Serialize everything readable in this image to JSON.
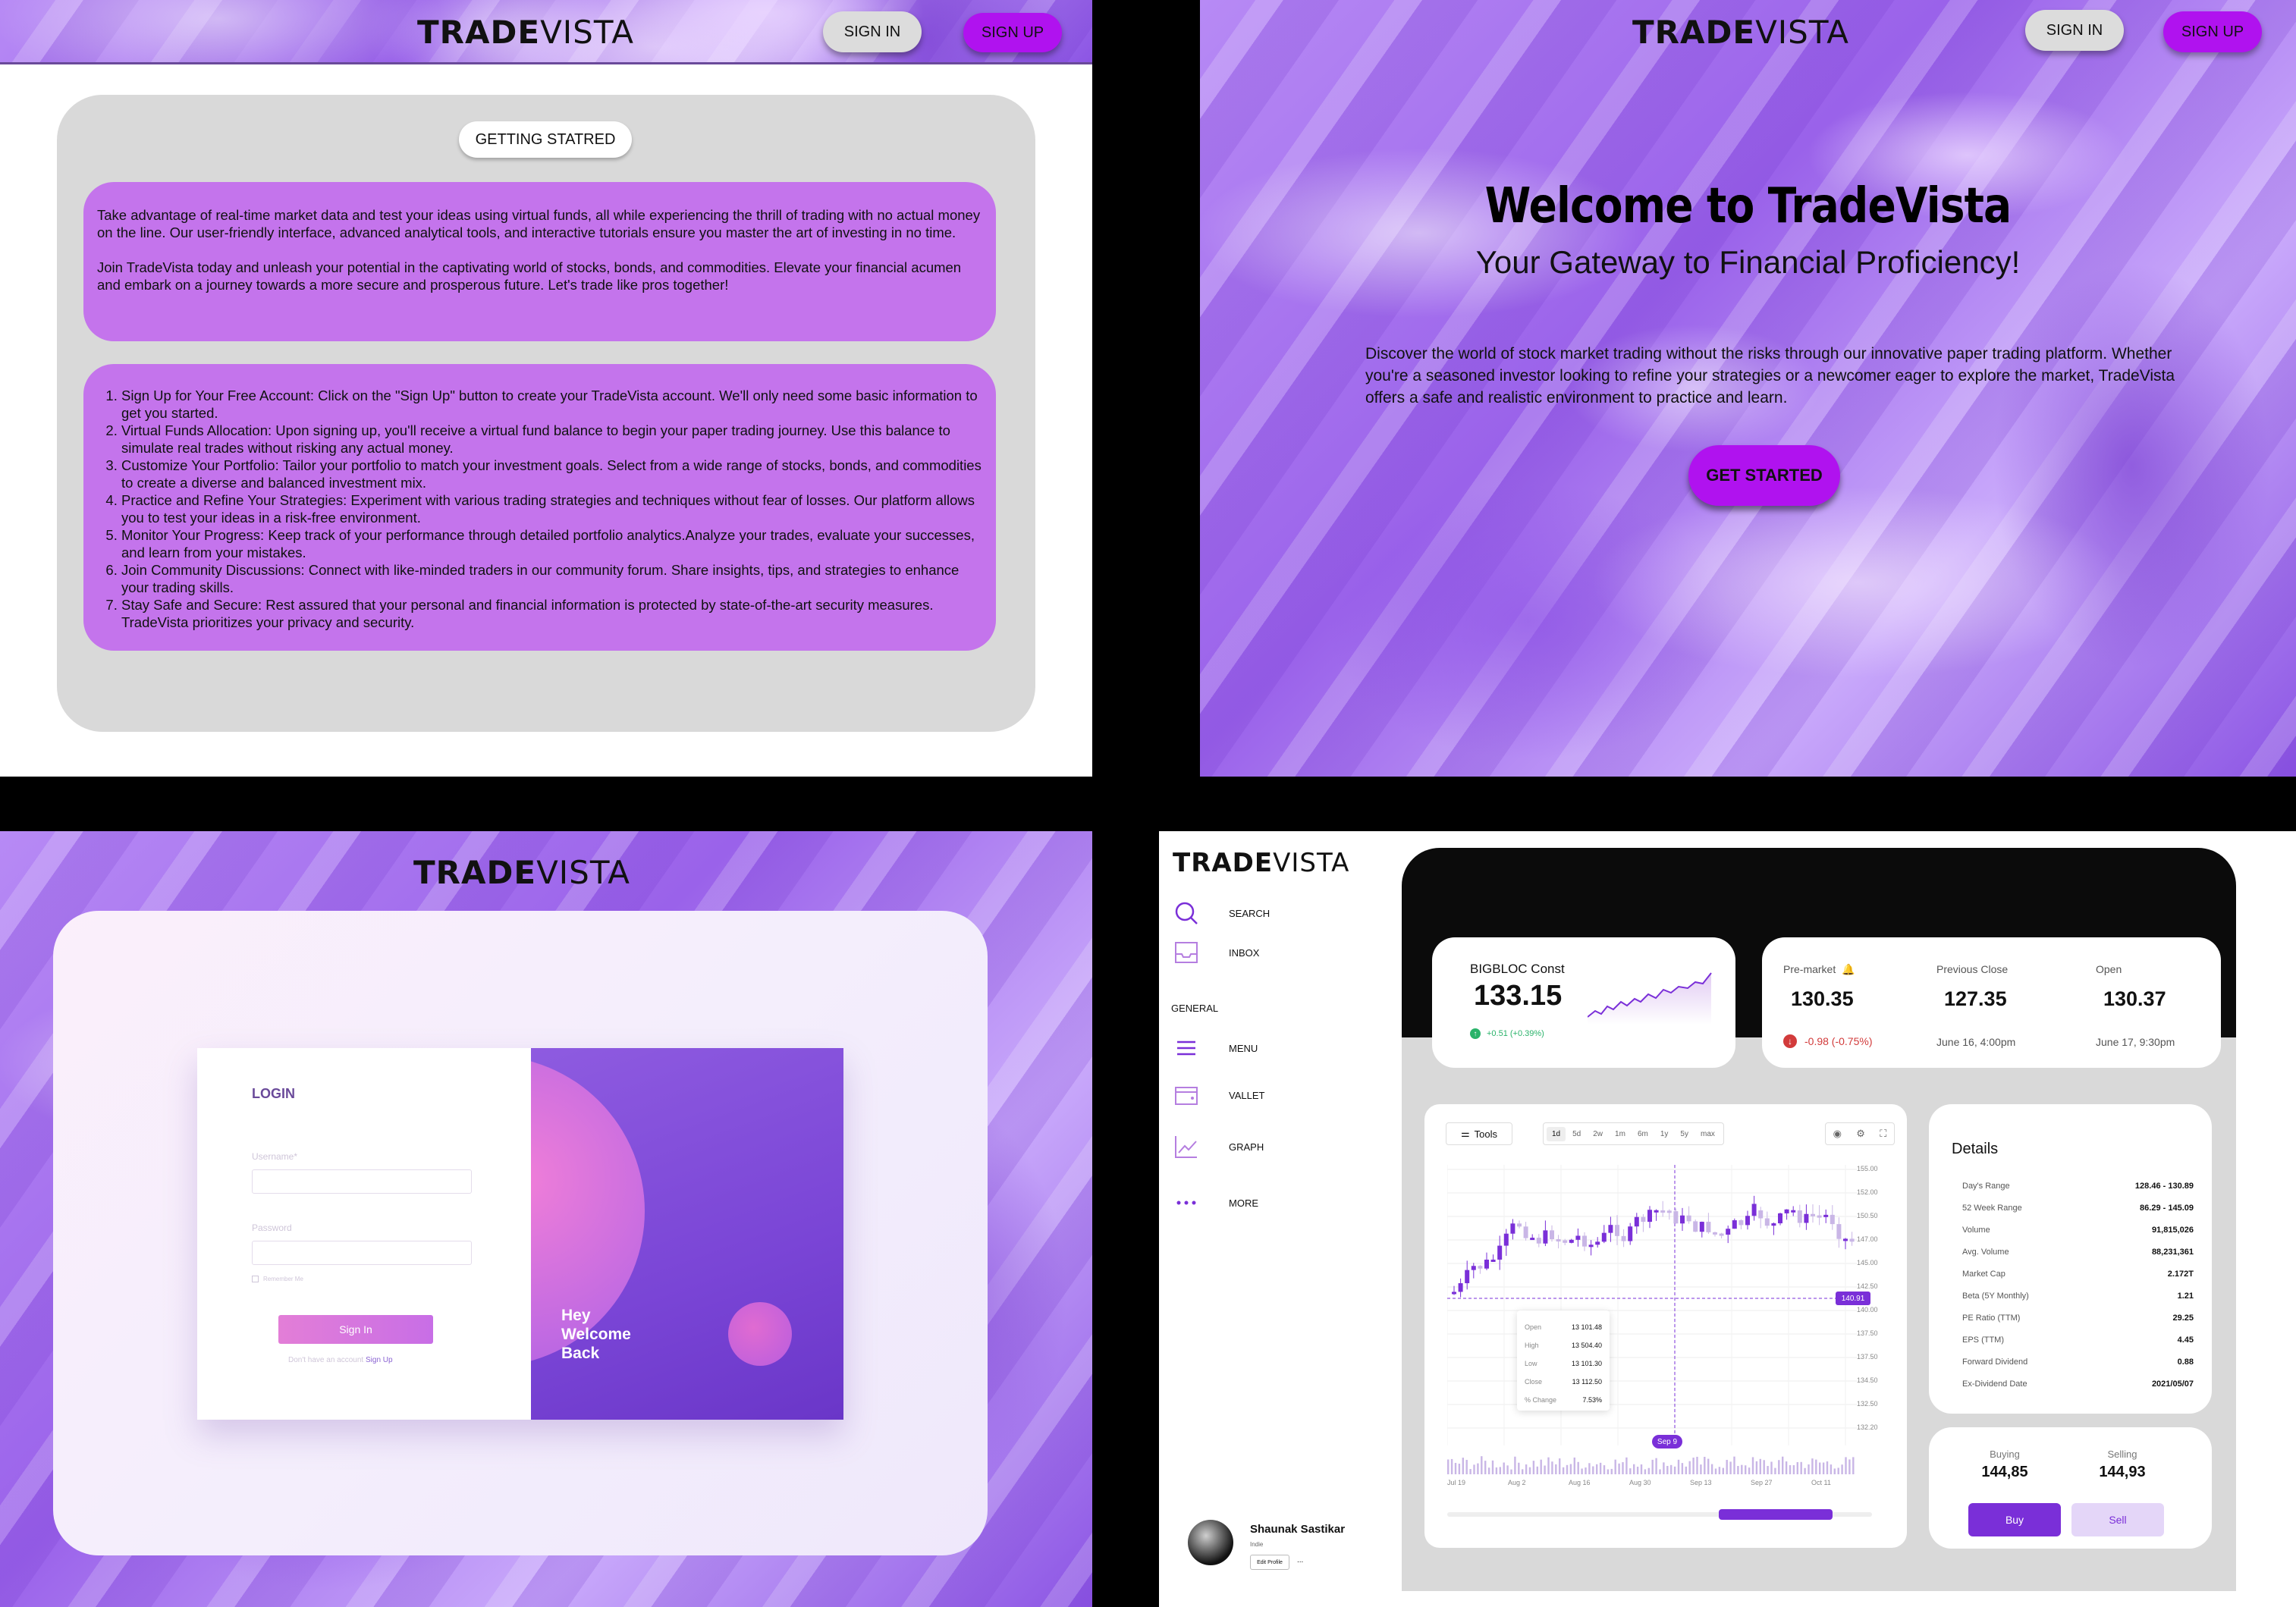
{
  "brand": {
    "bold": "TRADE",
    "light": "VISTA"
  },
  "q1": {
    "signin": "SIGN IN",
    "signup": "SIGN UP",
    "getting_started": "GETTING STATRED",
    "intro_p1": "Take advantage of real-time market data and test your ideas using virtual funds, all while experiencing the thrill of trading with no actual money on the line. Our user-friendly interface, advanced analytical tools, and interactive tutorials ensure you master the art of investing in no time.",
    "intro_p2": "Join TradeVista today and unleash your potential in the captivating world of stocks, bonds, and commodities. Elevate your financial acumen and embark on a journey towards a more secure and prosperous future. Let's trade like pros together!",
    "steps": [
      "Sign Up for Your Free Account: Click on the \"Sign Up\" button to create your TradeVista account. We'll only need some basic information to get you started.",
      "Virtual Funds Allocation: Upon signing up, you'll receive a virtual fund balance to begin your paper trading journey. Use this balance to simulate real trades without risking any actual money.",
      "Customize Your Portfolio: Tailor your portfolio to match your investment goals. Select from a wide range of stocks, bonds, and commodities to create a diverse and balanced investment mix.",
      "Practice and Refine Your Strategies: Experiment with various trading strategies and techniques without fear of losses. Our platform allows you to test your ideas in a risk-free environment.",
      "Monitor Your Progress: Keep track of your performance through detailed portfolio analytics.Analyze your trades, evaluate your successes, and learn from your mistakes.",
      "Join Community Discussions: Connect with like-minded traders in our community forum. Share insights, tips, and strategies to enhance your trading skills.",
      "Stay Safe and Secure: Rest assured that your personal and financial information is protected by state-of-the-art security measures. TradeVista prioritizes your privacy and security."
    ]
  },
  "q2": {
    "signin": "SIGN IN",
    "signup": "SIGN UP",
    "title": "Welcome to TradeVista",
    "subtitle": "Your Gateway to Financial Proficiency!",
    "description": "Discover the world of stock market trading without the risks through our innovative paper trading platform. Whether you're a seasoned investor looking to refine your strategies or a newcomer eager to explore the market, TradeVista offers a safe and realistic environment to practice and learn.",
    "cta": "GET STARTED"
  },
  "q3": {
    "login_title": "LOGIN",
    "username_label": "Username*",
    "password_label": "Password",
    "remember": "Remember Me",
    "signin_btn": "Sign In",
    "no_account": "Don't have an account ",
    "signup_link": "Sign Up",
    "welcome": "Hey\nWelcome\nBack"
  },
  "q4": {
    "nav": {
      "search": "SEARCH",
      "inbox": "INBOX",
      "general": "GENERAL",
      "menu": "MENU",
      "vallet": "VALLET",
      "graph": "GRAPH",
      "more": "MORE"
    },
    "profile": {
      "name": "Shaunak Sastikar",
      "sub": "Indie",
      "edit": "Edit Profile",
      "more": "..."
    },
    "ticker": {
      "name": "BIGBLOC Const",
      "price": "133.15",
      "change": "+0.51 (+0.39%)"
    },
    "quotes": [
      {
        "label": "Pre-market",
        "value": "130.35",
        "sub": "-0.98 (-0.75%)"
      },
      {
        "label": "Previous Close",
        "value": "127.35",
        "sub": "June 16, 4:00pm"
      },
      {
        "label": "Open",
        "value": "130.37",
        "sub": "June 17, 9:30pm"
      }
    ],
    "tools": "Tools",
    "ranges": [
      "1d",
      "5d",
      "2w",
      "1m",
      "6m",
      "1y",
      "5y",
      "max"
    ],
    "price_axis": [
      "155.00",
      "152.00",
      "150.50",
      "147.00",
      "145.00",
      "142.50",
      "140.00",
      "137.50",
      "137.50",
      "134.50",
      "132.50",
      "132.20"
    ],
    "date_axis": [
      "Jul 19",
      "Aug 2",
      "Aug 16",
      "Aug 30",
      "Sep 13",
      "Sep 27",
      "Oct 11"
    ],
    "current_price_tag": "140.91",
    "cursor_date": "Sep 9",
    "ohlc": [
      {
        "k": "Open",
        "v": "13 101.48"
      },
      {
        "k": "High",
        "v": "13 504.40"
      },
      {
        "k": "Low",
        "v": "13 101.30"
      },
      {
        "k": "Close",
        "v": "13 112.50"
      },
      {
        "k": "% Change",
        "v": "7.53%"
      }
    ],
    "details_title": "Details",
    "details": [
      {
        "k": "Day's Range",
        "v": "128.46 - 130.89"
      },
      {
        "k": "52 Week Range",
        "v": "86.29 - 145.09"
      },
      {
        "k": "Volume",
        "v": "91,815,026"
      },
      {
        "k": "Avg. Volume",
        "v": "88,231,361"
      },
      {
        "k": "Market Cap",
        "v": "2.172T"
      },
      {
        "k": "Beta (5Y Monthly)",
        "v": "1.21"
      },
      {
        "k": "PE Ratio (TTM)",
        "v": "29.25"
      },
      {
        "k": "EPS (TTM)",
        "v": "4.45"
      },
      {
        "k": "Forward Dividend",
        "v": "0.88"
      },
      {
        "k": "Ex-Dividend Date",
        "v": "2021/05/07"
      }
    ],
    "buying_label": "Buying",
    "buying": "144,85",
    "selling_label": "Selling",
    "selling": "144,93",
    "buy": "Buy",
    "sell": "Sell"
  },
  "colors": {
    "accent": "#b012ef",
    "purple": "#7a2fd8",
    "pink": "#c474ec"
  }
}
